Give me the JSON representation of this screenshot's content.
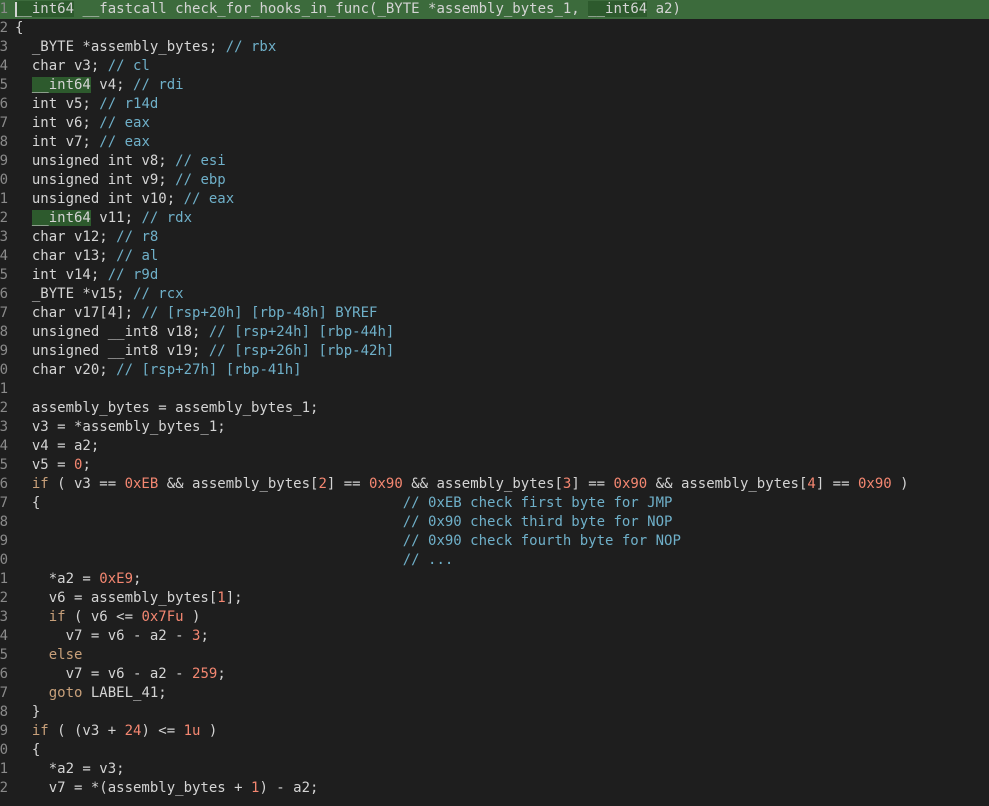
{
  "editor": {
    "language": "c-pseudocode",
    "colors": {
      "background": "#1e1e1e",
      "default": "#d4d4d4",
      "keyword": "#c8a07a",
      "number": "#f48771",
      "comment": "#6fb0c9",
      "highlight_line": "#3c6b3c",
      "highlight_token": "#2d5a2d",
      "line_number": "#8a8a8a"
    },
    "lines": [
      {
        "num": "1",
        "highlight": true,
        "tokens": [
          {
            "t": "__int64",
            "c": "type_hl"
          },
          {
            "t": " __fastcall check_for_hooks_in_func(_BYTE *assembly_bytes_1, ",
            "c": "default"
          },
          {
            "t": "__int64",
            "c": "type_hl"
          },
          {
            "t": " a2)",
            "c": "default"
          }
        ]
      },
      {
        "num": "2",
        "tokens": [
          {
            "t": "{",
            "c": "default"
          }
        ]
      },
      {
        "num": "3",
        "tokens": [
          {
            "t": "  _BYTE *assembly_bytes; ",
            "c": "default"
          },
          {
            "t": "// rbx",
            "c": "comment"
          }
        ]
      },
      {
        "num": "4",
        "tokens": [
          {
            "t": "  char v3; ",
            "c": "default"
          },
          {
            "t": "// cl",
            "c": "comment"
          }
        ]
      },
      {
        "num": "5",
        "tokens": [
          {
            "t": "  ",
            "c": "default"
          },
          {
            "t": "__int64",
            "c": "type_hl"
          },
          {
            "t": " v4; ",
            "c": "default"
          },
          {
            "t": "// rdi",
            "c": "comment"
          }
        ]
      },
      {
        "num": "6",
        "tokens": [
          {
            "t": "  int v5; ",
            "c": "default"
          },
          {
            "t": "// r14d",
            "c": "comment"
          }
        ]
      },
      {
        "num": "7",
        "tokens": [
          {
            "t": "  int v6; ",
            "c": "default"
          },
          {
            "t": "// eax",
            "c": "comment"
          }
        ]
      },
      {
        "num": "8",
        "tokens": [
          {
            "t": "  int v7; ",
            "c": "default"
          },
          {
            "t": "// eax",
            "c": "comment"
          }
        ]
      },
      {
        "num": "9",
        "tokens": [
          {
            "t": "  unsigned int v8; ",
            "c": "default"
          },
          {
            "t": "// esi",
            "c": "comment"
          }
        ]
      },
      {
        "num": "0",
        "tokens": [
          {
            "t": "  unsigned int v9; ",
            "c": "default"
          },
          {
            "t": "// ebp",
            "c": "comment"
          }
        ]
      },
      {
        "num": "1",
        "tokens": [
          {
            "t": "  unsigned int v10; ",
            "c": "default"
          },
          {
            "t": "// eax",
            "c": "comment"
          }
        ]
      },
      {
        "num": "2",
        "tokens": [
          {
            "t": "  ",
            "c": "default"
          },
          {
            "t": "__int64",
            "c": "type_hl"
          },
          {
            "t": " v11; ",
            "c": "default"
          },
          {
            "t": "// rdx",
            "c": "comment"
          }
        ]
      },
      {
        "num": "3",
        "tokens": [
          {
            "t": "  char v12; ",
            "c": "default"
          },
          {
            "t": "// r8",
            "c": "comment"
          }
        ]
      },
      {
        "num": "4",
        "tokens": [
          {
            "t": "  char v13; ",
            "c": "default"
          },
          {
            "t": "// al",
            "c": "comment"
          }
        ]
      },
      {
        "num": "5",
        "tokens": [
          {
            "t": "  int v14; ",
            "c": "default"
          },
          {
            "t": "// r9d",
            "c": "comment"
          }
        ]
      },
      {
        "num": "6",
        "tokens": [
          {
            "t": "  _BYTE *v15; ",
            "c": "default"
          },
          {
            "t": "// rcx",
            "c": "comment"
          }
        ]
      },
      {
        "num": "7",
        "tokens": [
          {
            "t": "  char v17[4]; ",
            "c": "default"
          },
          {
            "t": "// [rsp+20h] [rbp-48h] BYREF",
            "c": "comment"
          }
        ]
      },
      {
        "num": "8",
        "tokens": [
          {
            "t": "  unsigned __int8 v18; ",
            "c": "default"
          },
          {
            "t": "// [rsp+24h] [rbp-44h]",
            "c": "comment"
          }
        ]
      },
      {
        "num": "9",
        "tokens": [
          {
            "t": "  unsigned __int8 v19; ",
            "c": "default"
          },
          {
            "t": "// [rsp+26h] [rbp-42h]",
            "c": "comment"
          }
        ]
      },
      {
        "num": "0",
        "tokens": [
          {
            "t": "  char v20; ",
            "c": "default"
          },
          {
            "t": "// [rsp+27h] [rbp-41h]",
            "c": "comment"
          }
        ]
      },
      {
        "num": "1",
        "tokens": []
      },
      {
        "num": "2",
        "tokens": [
          {
            "t": "  assembly_bytes = assembly_bytes_1;",
            "c": "default"
          }
        ]
      },
      {
        "num": "3",
        "tokens": [
          {
            "t": "  v3 = *assembly_bytes_1;",
            "c": "default"
          }
        ]
      },
      {
        "num": "4",
        "tokens": [
          {
            "t": "  v4 = a2;",
            "c": "default"
          }
        ]
      },
      {
        "num": "5",
        "tokens": [
          {
            "t": "  v5 = ",
            "c": "default"
          },
          {
            "t": "0",
            "c": "number"
          },
          {
            "t": ";",
            "c": "default"
          }
        ]
      },
      {
        "num": "6",
        "tokens": [
          {
            "t": "  ",
            "c": "default"
          },
          {
            "t": "if",
            "c": "keyword"
          },
          {
            "t": " ( v3 == ",
            "c": "default"
          },
          {
            "t": "0xEB",
            "c": "number"
          },
          {
            "t": " && assembly_bytes[",
            "c": "default"
          },
          {
            "t": "2",
            "c": "number"
          },
          {
            "t": "] == ",
            "c": "default"
          },
          {
            "t": "0x90",
            "c": "number"
          },
          {
            "t": " && assembly_bytes[",
            "c": "default"
          },
          {
            "t": "3",
            "c": "number"
          },
          {
            "t": "] == ",
            "c": "default"
          },
          {
            "t": "0x90",
            "c": "number"
          },
          {
            "t": " && assembly_bytes[",
            "c": "default"
          },
          {
            "t": "4",
            "c": "number"
          },
          {
            "t": "] == ",
            "c": "default"
          },
          {
            "t": "0x90",
            "c": "number"
          },
          {
            "t": " )",
            "c": "default"
          }
        ]
      },
      {
        "num": "7",
        "tokens": [
          {
            "t": "  {                                           ",
            "c": "default"
          },
          {
            "t": "// 0xEB check first byte for JMP",
            "c": "comment"
          }
        ]
      },
      {
        "num": "8",
        "tokens": [
          {
            "t": "                                              ",
            "c": "default"
          },
          {
            "t": "// 0x90 check third byte for NOP",
            "c": "comment"
          }
        ]
      },
      {
        "num": "9",
        "tokens": [
          {
            "t": "                                              ",
            "c": "default"
          },
          {
            "t": "// 0x90 check fourth byte for NOP",
            "c": "comment"
          }
        ]
      },
      {
        "num": "0",
        "tokens": [
          {
            "t": "                                              ",
            "c": "default"
          },
          {
            "t": "// ...",
            "c": "comment"
          }
        ]
      },
      {
        "num": "1",
        "tokens": [
          {
            "t": "    *a2 = ",
            "c": "default"
          },
          {
            "t": "0xE9",
            "c": "number"
          },
          {
            "t": ";",
            "c": "default"
          }
        ]
      },
      {
        "num": "2",
        "tokens": [
          {
            "t": "    v6 = assembly_bytes[",
            "c": "default"
          },
          {
            "t": "1",
            "c": "number"
          },
          {
            "t": "];",
            "c": "default"
          }
        ]
      },
      {
        "num": "3",
        "tokens": [
          {
            "t": "    ",
            "c": "default"
          },
          {
            "t": "if",
            "c": "keyword"
          },
          {
            "t": " ( v6 <= ",
            "c": "default"
          },
          {
            "t": "0x7Fu",
            "c": "number"
          },
          {
            "t": " )",
            "c": "default"
          }
        ]
      },
      {
        "num": "4",
        "tokens": [
          {
            "t": "      v7 = v6 - a2 - ",
            "c": "default"
          },
          {
            "t": "3",
            "c": "number"
          },
          {
            "t": ";",
            "c": "default"
          }
        ]
      },
      {
        "num": "5",
        "tokens": [
          {
            "t": "    ",
            "c": "default"
          },
          {
            "t": "else",
            "c": "keyword"
          }
        ]
      },
      {
        "num": "6",
        "tokens": [
          {
            "t": "      v7 = v6 - a2 - ",
            "c": "default"
          },
          {
            "t": "259",
            "c": "number"
          },
          {
            "t": ";",
            "c": "default"
          }
        ]
      },
      {
        "num": "7",
        "tokens": [
          {
            "t": "    ",
            "c": "default"
          },
          {
            "t": "goto",
            "c": "keyword"
          },
          {
            "t": " LABEL_41;",
            "c": "label"
          }
        ]
      },
      {
        "num": "8",
        "tokens": [
          {
            "t": "  }",
            "c": "default"
          }
        ]
      },
      {
        "num": "9",
        "tokens": [
          {
            "t": "  ",
            "c": "default"
          },
          {
            "t": "if",
            "c": "keyword"
          },
          {
            "t": " ( (v3 + ",
            "c": "default"
          },
          {
            "t": "24",
            "c": "number"
          },
          {
            "t": ") <= ",
            "c": "default"
          },
          {
            "t": "1u",
            "c": "number"
          },
          {
            "t": " )",
            "c": "default"
          }
        ]
      },
      {
        "num": "0",
        "tokens": [
          {
            "t": "  {",
            "c": "default"
          }
        ]
      },
      {
        "num": "1",
        "tokens": [
          {
            "t": "    *a2 = v3;",
            "c": "default"
          }
        ]
      },
      {
        "num": "2",
        "tokens": [
          {
            "t": "    v7 = *(assembly_bytes + ",
            "c": "default"
          },
          {
            "t": "1",
            "c": "number"
          },
          {
            "t": ") - a2;",
            "c": "default"
          }
        ]
      }
    ]
  }
}
